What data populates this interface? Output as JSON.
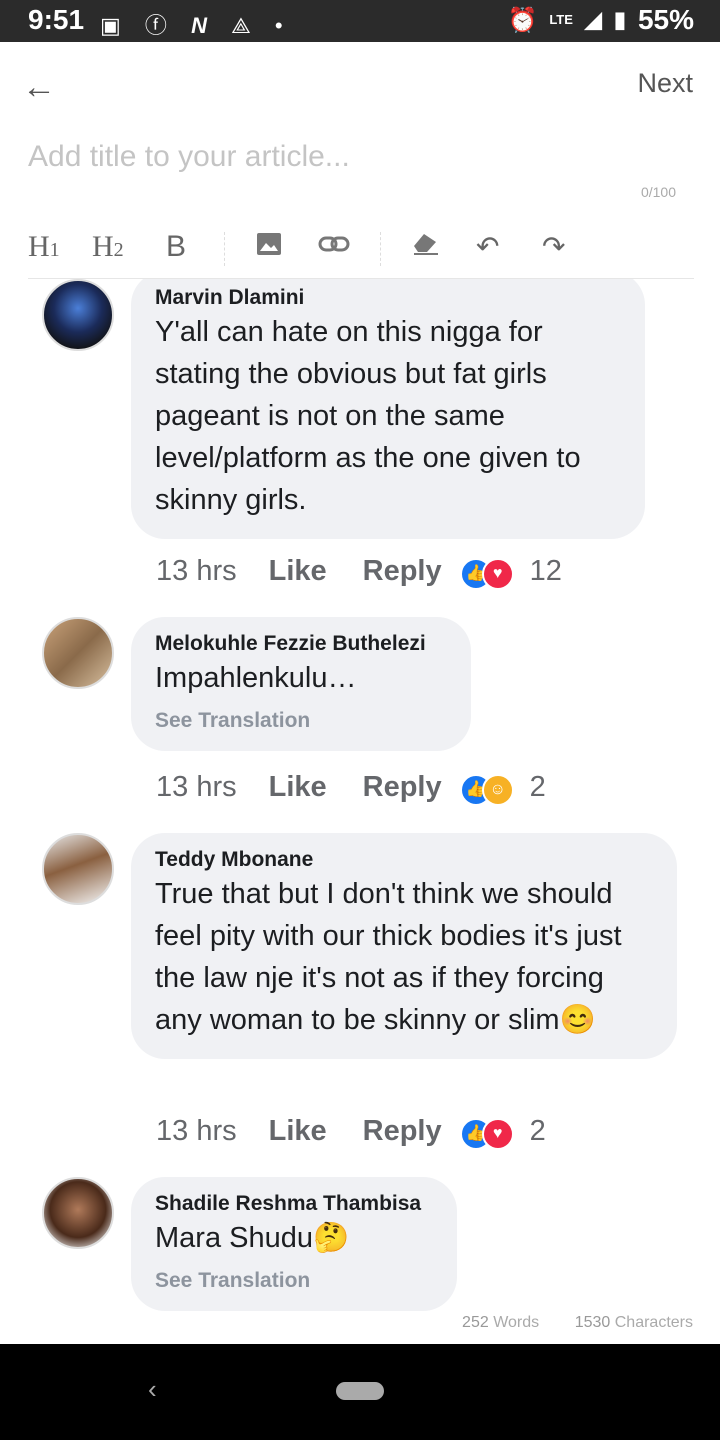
{
  "statusbar": {
    "time": "9:51",
    "battery": "55%",
    "network": "LTE"
  },
  "header": {
    "next_label": "Next"
  },
  "editor": {
    "title_placeholder": "Add title to your article...",
    "char_count": "0/100"
  },
  "comments": [
    {
      "name": "Marvin Dlamini",
      "text": "Y'all can hate on this nigga for stating the obvious but fat girls pageant is not on the same level/platform as the one given to skinny girls.",
      "time": "13 hrs",
      "like": "Like",
      "reply": "Reply",
      "reactions": "12"
    },
    {
      "name": "Melokuhle Fezzie Buthelezi",
      "text": "Impahlenkulu…",
      "translation": "See Translation",
      "time": "13 hrs",
      "like": "Like",
      "reply": "Reply",
      "reactions": "2"
    },
    {
      "name": "Teddy Mbonane",
      "text": "True that but I don't think we should feel pity with our thick bodies it's just the law nje it's not as if they forcing any woman to be skinny or slim😊",
      "time": "13 hrs",
      "like": "Like",
      "reply": "Reply",
      "reactions": "2"
    },
    {
      "name": "Shadile Reshma Thambisa",
      "text": "Mara Shudu🤔",
      "translation": "See Translation"
    }
  ],
  "footer": {
    "words_count": "252",
    "words_label": "Words",
    "chars_count": "1530",
    "chars_label": "Characters"
  },
  "colors": {
    "like_blue": "#1877f2",
    "love_red": "#f02849",
    "bubble": "#f0f1f4"
  }
}
